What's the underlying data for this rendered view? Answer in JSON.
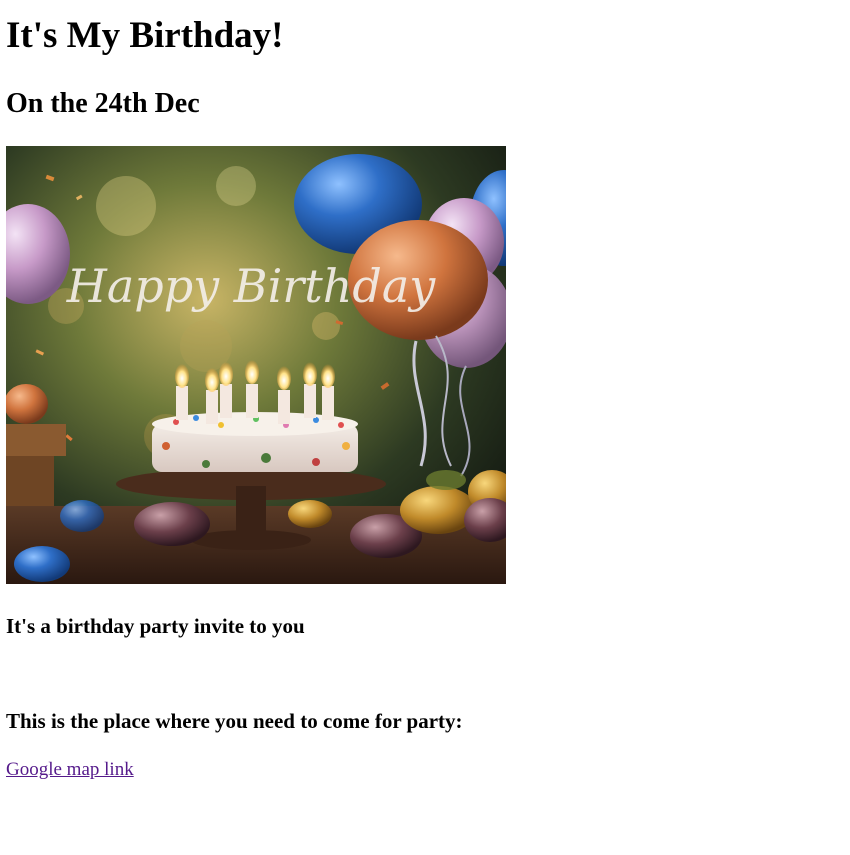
{
  "heading": "It's My Birthday!",
  "subheading": "On the 24th Dec",
  "image": {
    "alt": "Happy Birthday cake with candles and balloons",
    "overlay_text": "Happy Birthday"
  },
  "invite_text": "It's a birthday party invite to you",
  "place_text": "This is the place where you need to come for party:",
  "map_link": {
    "label": "Google map link",
    "color": "#551a8b"
  }
}
